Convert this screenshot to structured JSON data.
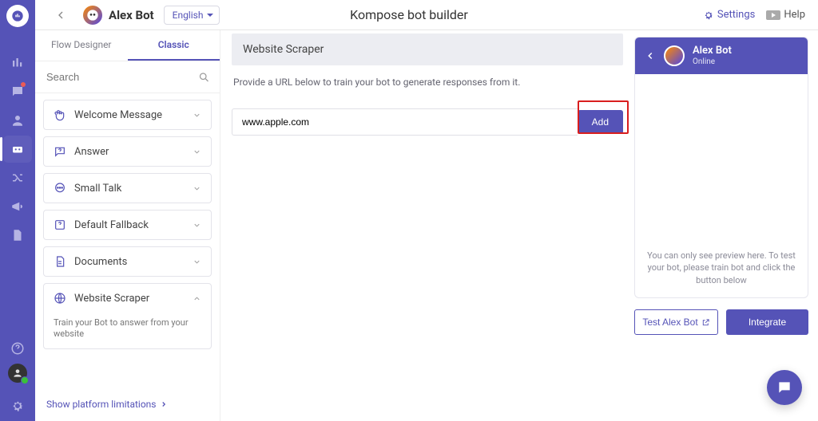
{
  "header": {
    "bot_name": "Alex Bot",
    "language": "English",
    "page_title": "Kompose bot builder",
    "settings": "Settings",
    "help": "Help"
  },
  "tabs": {
    "flow_designer": "Flow Designer",
    "classic": "Classic"
  },
  "search": {
    "placeholder": "Search"
  },
  "categories": {
    "welcome": "Welcome Message",
    "answer": "Answer",
    "small_talk": "Small Talk",
    "fallback": "Default Fallback",
    "documents": "Documents",
    "scraper": "Website Scraper",
    "scraper_sub": "Train your Bot to answer from your website"
  },
  "show_limitations": "Show platform limitations",
  "center": {
    "title": "Website Scraper",
    "desc": "Provide a URL below to train your bot to generate responses from it.",
    "url_value": "www.apple.com",
    "add": "Add"
  },
  "preview": {
    "bot_name": "Alex Bot",
    "status": "Online",
    "note": "You can only see preview here. To test your bot, please train bot and click the button below",
    "test": "Test Alex Bot",
    "integrate": "Integrate"
  }
}
